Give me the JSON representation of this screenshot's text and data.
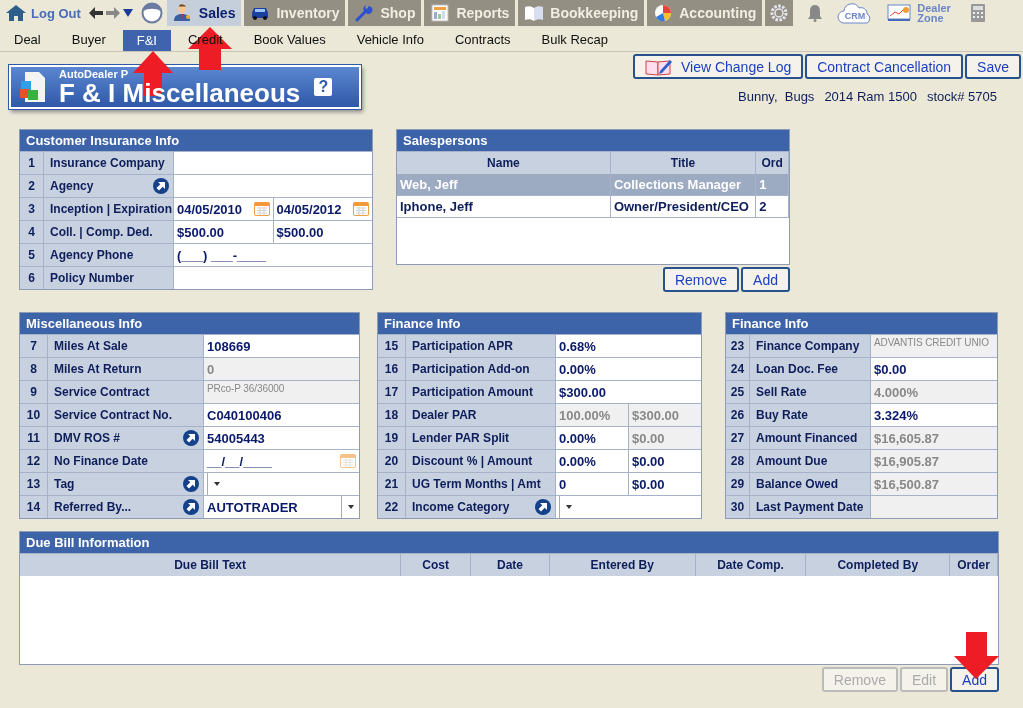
{
  "topbar": {
    "logout": "Log Out",
    "modules": [
      {
        "label": "Sales",
        "selected": true
      },
      {
        "label": "Inventory",
        "selected": false
      },
      {
        "label": "Shop",
        "selected": false
      },
      {
        "label": "Reports",
        "selected": false
      },
      {
        "label": "Bookkeeping",
        "selected": false
      },
      {
        "label": "Accounting",
        "selected": false
      }
    ],
    "crm": "CRM",
    "dealer_zone": "Dealer Zone"
  },
  "subtabs": [
    {
      "label": "Deal",
      "selected": false
    },
    {
      "label": "Buyer",
      "selected": false
    },
    {
      "label": "F&I",
      "selected": true
    },
    {
      "label": "Credit",
      "selected": false
    },
    {
      "label": "Book Values",
      "selected": false
    },
    {
      "label": "Vehicle Info",
      "selected": false
    },
    {
      "label": "Contracts",
      "selected": false
    },
    {
      "label": "Bulk Recap",
      "selected": false
    }
  ],
  "page": {
    "subtitle": "AutoDealer P",
    "title": "F & I Miscellaneous",
    "help": "?"
  },
  "actions": [
    "View Change Log",
    "Contract Cancellation",
    "Save"
  ],
  "deal_info": {
    "customer": "Bunny,  Bugs",
    "vehicle": "2014 Ram 1500",
    "stock": "stock# 5705"
  },
  "customer_insurance": {
    "title": "Customer Insurance Info",
    "rows": [
      {
        "num": "1",
        "label": "Insurance Company",
        "link": false,
        "cells": [
          {
            "kind": "text",
            "disabled": false
          }
        ]
      },
      {
        "num": "2",
        "label": "Agency",
        "link": true,
        "cells": [
          {
            "kind": "text",
            "disabled": false
          }
        ]
      },
      {
        "num": "3",
        "label": "Inception | Expiration",
        "link": false,
        "cells": [
          {
            "kind": "date",
            "value": "04/05/2010",
            "disabled": false
          },
          {
            "kind": "date",
            "value": "04/05/2012",
            "disabled": false
          }
        ]
      },
      {
        "num": "4",
        "label": "Coll. | Comp. Ded.",
        "link": false,
        "cells": [
          {
            "kind": "text",
            "value": "$500.00",
            "disabled": false
          },
          {
            "kind": "text",
            "value": "$500.00",
            "disabled": false
          }
        ]
      },
      {
        "num": "5",
        "label": "Agency Phone",
        "link": false,
        "cells": [
          {
            "kind": "text",
            "value": "(___) ___-____",
            "disabled": false
          }
        ]
      },
      {
        "num": "6",
        "label": "Policy Number",
        "link": false,
        "cells": [
          {
            "kind": "text",
            "disabled": false
          }
        ]
      }
    ]
  },
  "salespersons": {
    "title": "Salespersons",
    "columns": [
      "Name",
      "Title",
      "Ord"
    ],
    "rows": [
      {
        "cells": [
          "Web, Jeff",
          "Collections Manager",
          "1"
        ],
        "selected": true
      },
      {
        "cells": [
          "Iphone, Jeff",
          "Owner/President/CEO",
          "2"
        ],
        "selected": false
      }
    ],
    "buttons": [
      {
        "label": "Remove",
        "disabled": false
      },
      {
        "label": "Add",
        "disabled": false
      }
    ]
  },
  "misc_info": {
    "title": "Miscellaneous Info",
    "rows": [
      {
        "num": "7",
        "label": "Miles At Sale",
        "link": false,
        "cells": [
          {
            "kind": "text",
            "value": "108669",
            "disabled": false
          }
        ]
      },
      {
        "num": "8",
        "label": "Miles At Return",
        "link": false,
        "cells": [
          {
            "kind": "text",
            "value": "0",
            "disabled": true
          }
        ]
      },
      {
        "num": "9",
        "label": "Service Contract",
        "link": false,
        "cells": [
          {
            "kind": "note",
            "value": "PRco-P 36/36000",
            "disabled": true
          }
        ]
      },
      {
        "num": "10",
        "label": "Service Contract No.",
        "link": false,
        "cells": [
          {
            "kind": "text",
            "value": "C040100406",
            "disabled": false
          }
        ]
      },
      {
        "num": "11",
        "label": "DMV ROS #",
        "link": true,
        "cells": [
          {
            "kind": "text",
            "value": "54005443",
            "disabled": false
          }
        ]
      },
      {
        "num": "12",
        "label": "No Finance Date",
        "link": false,
        "cells": [
          {
            "kind": "date",
            "value": "__/__/____",
            "disabled": false
          }
        ]
      },
      {
        "num": "13",
        "label": "Tag",
        "link": true,
        "cells": [
          {
            "kind": "select",
            "disabled": false
          }
        ]
      },
      {
        "num": "14",
        "label": "Referred By...",
        "link": true,
        "cells": [
          {
            "kind": "select",
            "value": "AUTOTRADER",
            "disabled": false
          }
        ]
      }
    ]
  },
  "finance_info": {
    "title": "Finance Info",
    "rows": [
      {
        "num": "15",
        "label": "Participation APR",
        "link": false,
        "cells": [
          {
            "kind": "text",
            "value": "0.68%",
            "disabled": false
          }
        ]
      },
      {
        "num": "16",
        "label": "Participation Add-on",
        "link": false,
        "cells": [
          {
            "kind": "text",
            "value": "0.00%",
            "disabled": false
          }
        ]
      },
      {
        "num": "17",
        "label": "Participation Amount",
        "link": false,
        "cells": [
          {
            "kind": "text",
            "value": "$300.00",
            "disabled": false
          }
        ]
      },
      {
        "num": "18",
        "label": "Dealer PAR",
        "link": false,
        "cells": [
          {
            "kind": "text",
            "value": "100.00%",
            "disabled": true
          },
          {
            "kind": "text",
            "value": "$300.00",
            "disabled": true
          }
        ]
      },
      {
        "num": "19",
        "label": "Lender PAR Split",
        "link": false,
        "cells": [
          {
            "kind": "text",
            "value": "0.00%",
            "disabled": false
          },
          {
            "kind": "text",
            "value": "$0.00",
            "disabled": true
          }
        ]
      },
      {
        "num": "20",
        "label": "Discount % | Amount",
        "link": false,
        "cells": [
          {
            "kind": "text",
            "value": "0.00%",
            "disabled": false
          },
          {
            "kind": "text",
            "value": "$0.00",
            "disabled": false
          }
        ]
      },
      {
        "num": "21",
        "label": "UG Term Months | Amt",
        "link": false,
        "cells": [
          {
            "kind": "text",
            "value": "0",
            "disabled": false
          },
          {
            "kind": "text",
            "value": "$0.00",
            "disabled": false
          }
        ]
      },
      {
        "num": "22",
        "label": "Income Category",
        "link": true,
        "cells": [
          {
            "kind": "select",
            "disabled": false
          }
        ]
      }
    ]
  },
  "finance_info_2": {
    "title": "Finance Info",
    "rows": [
      {
        "num": "23",
        "label": "Finance Company",
        "link": false,
        "cells": [
          {
            "kind": "note",
            "value": "ADVANTIS CREDIT UNIO",
            "disabled": true
          }
        ]
      },
      {
        "num": "24",
        "label": "Loan Doc. Fee",
        "link": false,
        "cells": [
          {
            "kind": "text",
            "value": "$0.00",
            "disabled": false
          }
        ]
      },
      {
        "num": "25",
        "label": "Sell Rate",
        "link": false,
        "cells": [
          {
            "kind": "text",
            "value": "4.000%",
            "disabled": true
          }
        ]
      },
      {
        "num": "26",
        "label": "Buy Rate",
        "link": false,
        "cells": [
          {
            "kind": "text",
            "value": "3.324%",
            "disabled": false
          }
        ]
      },
      {
        "num": "27",
        "label": "Amount Financed",
        "link": false,
        "cells": [
          {
            "kind": "text",
            "value": "$16,605.87",
            "disabled": true
          }
        ]
      },
      {
        "num": "28",
        "label": "Amount Due",
        "link": false,
        "cells": [
          {
            "kind": "text",
            "value": "$16,905.87",
            "disabled": true
          }
        ]
      },
      {
        "num": "29",
        "label": "Balance Owed",
        "link": false,
        "cells": [
          {
            "kind": "text",
            "value": "$16,500.87",
            "disabled": true
          }
        ]
      },
      {
        "num": "30",
        "label": "Last Payment Date",
        "link": false,
        "cells": [
          {
            "kind": "text",
            "disabled": true
          }
        ]
      }
    ]
  },
  "due_bill": {
    "title": "Due Bill Information",
    "columns": [
      "Due Bill Text",
      "Cost",
      "Date",
      "Entered By",
      "Date Comp.",
      "Completed By",
      "Order"
    ],
    "buttons": [
      {
        "label": "Remove",
        "disabled": true
      },
      {
        "label": "Edit",
        "disabled": true
      },
      {
        "label": "Add",
        "disabled": false
      }
    ]
  }
}
